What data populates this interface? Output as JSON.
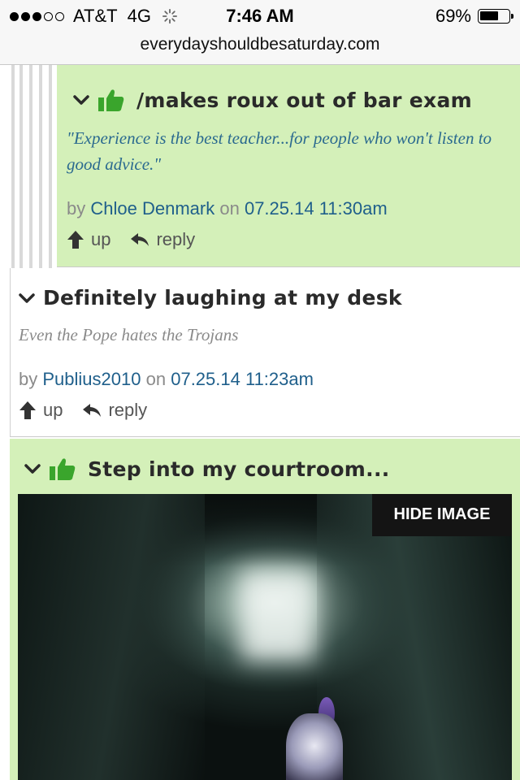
{
  "status_bar": {
    "signal_bars_filled": 3,
    "signal_bars_total": 5,
    "carrier": "AT&T",
    "network": "4G",
    "time": "7:46 AM",
    "battery_percent": "69%",
    "battery_level": 0.69
  },
  "url_bar": {
    "url": "everydayshouldbesaturday.com"
  },
  "comments": [
    {
      "title": "/makes roux out of bar exam",
      "body": "\"Experience is the best teacher...for people who won't listen to good advice.\"",
      "by_label": "by",
      "author": "Chloe Denmark",
      "on_label": "on",
      "timestamp": "07.25.14 11:30am",
      "up_label": "up",
      "reply_label": "reply",
      "has_thumb": true,
      "background": "#d4f0b9"
    },
    {
      "title": "Definitely laughing at my desk",
      "body": "Even the Pope hates the Trojans",
      "by_label": "by",
      "author": "Publius2010",
      "on_label": "on",
      "timestamp": "07.25.14 11:23am",
      "up_label": "up",
      "reply_label": "reply",
      "has_thumb": false,
      "background": "#ffffff"
    },
    {
      "title": "Step into my courtroom...",
      "has_thumb": true,
      "background": "#d4f0b9",
      "image": {
        "hide_button_label": "HIDE IMAGE"
      }
    }
  ],
  "colors": {
    "highlight_green": "#d4f0b9",
    "link_blue": "#1f5f8b",
    "quote_blue": "#2b6a8f",
    "thumb_green": "#3aa52c"
  },
  "icons": {
    "collapse": "chevron-down-icon",
    "liked": "thumbs-up-icon",
    "upvote": "arrow-up-icon",
    "reply": "reply-arrow-icon"
  }
}
